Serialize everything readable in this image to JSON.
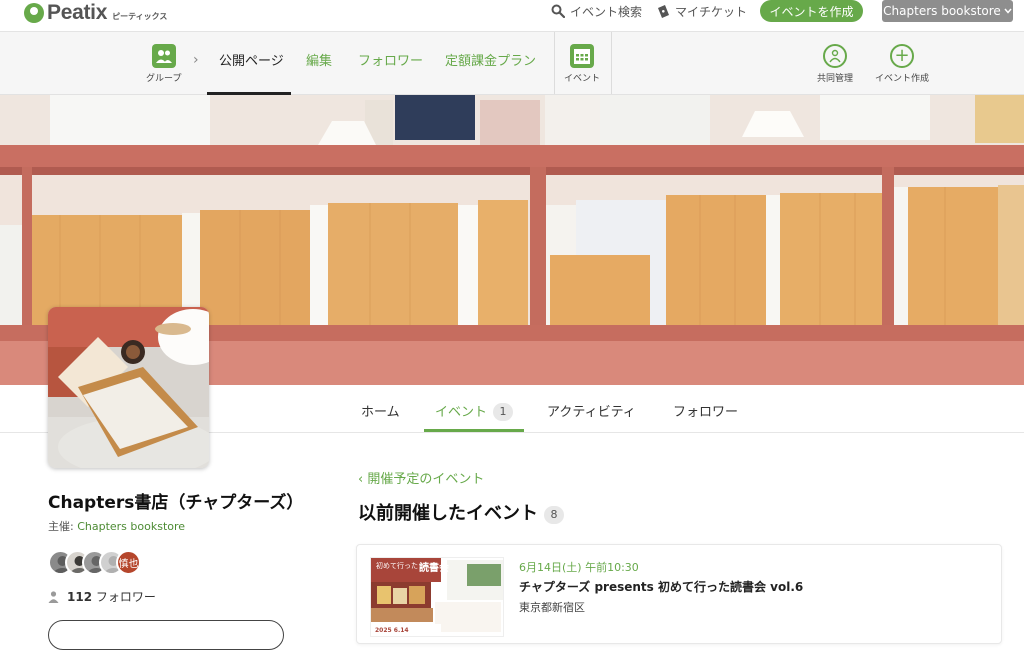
{
  "topbar": {
    "logo_text": "Peatix",
    "logo_sub": "ピーティックス",
    "search_label": "イベント検索",
    "mytickets_label": "マイチケット",
    "create_label": "イベントを作成",
    "account_label": "Chapters bookstore"
  },
  "groupnav": {
    "group_label": "グループ",
    "tabs": [
      {
        "label": "公開ページ"
      },
      {
        "label": "編集"
      },
      {
        "label": "フォロワー"
      },
      {
        "label": "定額課金プラン"
      }
    ],
    "events_label": "イベント",
    "comanage_label": "共同管理",
    "create_event_label": "イベント作成"
  },
  "profile_tabs": [
    {
      "label": "ホーム"
    },
    {
      "label": "イベント",
      "badge": "1"
    },
    {
      "label": "アクティビティ"
    },
    {
      "label": "フォロワー"
    }
  ],
  "profile": {
    "name": "Chapters書店（チャプターズ）",
    "organizer_prefix": "主催: ",
    "organizer": "Chapters bookstore",
    "member_initials": "慎也",
    "followers_count": "112",
    "followers_label": "フォロワー"
  },
  "events": {
    "upcoming_link": "開催予定のイベント",
    "past_title": "以前開催したイベント",
    "past_count": "8",
    "items": [
      {
        "date": "6月14日(土) 午前10:30",
        "title": "チャプターズ presents 初めて行った読書会 vol.6",
        "place": "東京都新宿区",
        "thumb_caption": "初めて行った",
        "thumb_heading": "読書会",
        "thumb_date": "2025 6.14"
      }
    ]
  },
  "colors": {
    "brand_green": "#67a94a",
    "account_gray": "#8e8e8e"
  }
}
